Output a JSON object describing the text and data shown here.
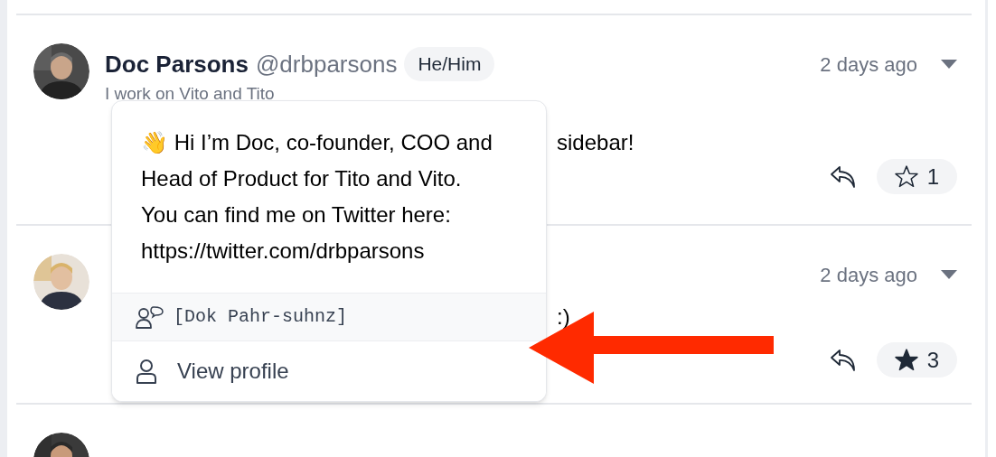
{
  "posts": [
    {
      "name": "Doc Parsons",
      "handle": "@drbparsons",
      "pronouns": "He/Him",
      "bio": "I work on Vito and Tito",
      "time": "2 days ago",
      "message_parts": [
        {
          "kind": "right",
          "text": "sidebar!"
        }
      ],
      "starred": false,
      "star_count": "1"
    },
    {
      "time": "2 days ago",
      "message_parts": [
        {
          "kind": "right",
          "text": ":)"
        }
      ],
      "starred": true,
      "star_count": "3"
    },
    {
      "kind": "cut_off"
    }
  ],
  "popover": {
    "bio": "👋 Hi I’m Doc, co-founder, COO and Head of Product for Tito and Vito. You can find me on Twitter here: https://twitter.com/drbparsons",
    "pronunciation": "[Dok Pahr-suhnz]",
    "menu_items": [
      {
        "label": "View profile"
      }
    ]
  }
}
